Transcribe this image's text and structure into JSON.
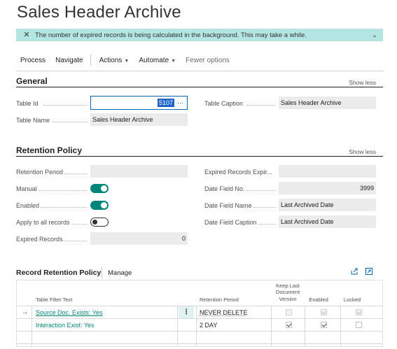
{
  "page": {
    "title": "Sales Header Archive"
  },
  "banner": {
    "message": "The number of expired records is being calculated in the background. This may take a while.",
    "close_icon": "close-icon",
    "expand_icon": "chevron-down-icon",
    "color": "#b3e5e2"
  },
  "actions": {
    "process": "Process",
    "navigate": "Navigate",
    "actions": "Actions",
    "automate": "Automate",
    "fewer_options": "Fewer options"
  },
  "general": {
    "title": "General",
    "show_less": "Show less",
    "table_id_label": "Table Id",
    "table_id_value": "5107",
    "table_name_label": "Table Name",
    "table_name_value": "Sales Header Archive",
    "table_caption_label": "Table Caption",
    "table_caption_value": "Sales Header Archive"
  },
  "retention": {
    "title": "Retention Policy",
    "show_less": "Show less",
    "retention_period_label": "Retention Period",
    "retention_period_value": "",
    "manual_label": "Manual",
    "manual_on": true,
    "enabled_label": "Enabled",
    "enabled_on": true,
    "apply_all_label": "Apply to all records",
    "apply_all_on": false,
    "expired_records_label": "Expired Records",
    "expired_records_value": "0",
    "expired_exp_label": "Expired Records Expir...",
    "expired_exp_value": "",
    "date_field_no_label": "Date Field No.",
    "date_field_no_value": "3999",
    "date_field_name_label": "Date Field Name",
    "date_field_name_value": "Last Archived Date",
    "date_field_caption_label": "Date Field Caption",
    "date_field_caption_value": "Last Archived Date",
    "accent_color": "#00857a"
  },
  "record_policy": {
    "title": "Record Retention Policy",
    "manage": "Manage",
    "columns": {
      "filter": "Table Filter Text",
      "period": "Retention Period",
      "keep_last": "Keep Last Document Version",
      "enabled": "Enabled",
      "locked": "Locked"
    },
    "rows": [
      {
        "filter": "Source Doc. Exists: Yes",
        "period": "NEVER DELETE",
        "keep_last": false,
        "enabled": true,
        "locked": true,
        "disabled": true
      },
      {
        "filter": "Interaction Exist: Yes",
        "period": "2 DAY",
        "keep_last": true,
        "enabled": true,
        "locked": false,
        "disabled": false
      }
    ]
  }
}
